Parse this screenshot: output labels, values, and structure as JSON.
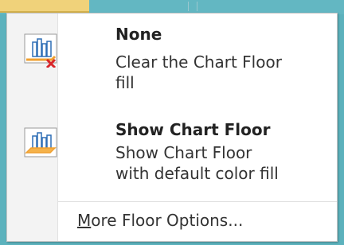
{
  "menu": {
    "items": [
      {
        "title": "None",
        "desc_line1": "Clear the Chart Floor",
        "desc_line2": "fill",
        "icon": "chart-floor-none-icon"
      },
      {
        "title": "Show Chart Floor",
        "desc_line1": "Show Chart Floor",
        "desc_line2": "with default color fill",
        "icon": "chart-floor-show-icon"
      }
    ],
    "more_label_accel": "M",
    "more_label_rest": "ore Floor Options..."
  },
  "colors": {
    "background": "#5cb2bd",
    "icon_blue": "#2f6fb5",
    "floor_orange": "#f0a030",
    "clear_red": "#d8262a"
  }
}
